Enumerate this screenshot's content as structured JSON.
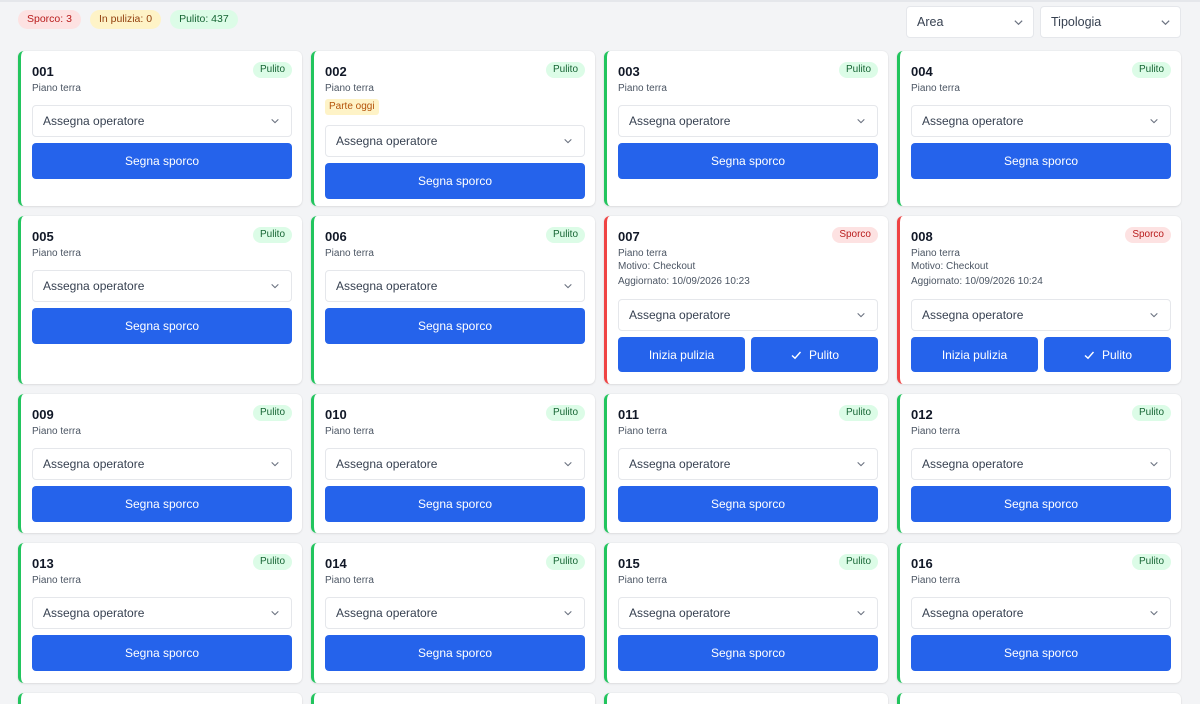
{
  "summary": {
    "dirty": "Sporco: 3",
    "cleaning": "In pulizia: 0",
    "clean": "Pulito: 437"
  },
  "filters": {
    "area": "Area",
    "type": "Tipologia"
  },
  "labels": {
    "assign": "Assegna operatore",
    "mark_dirty": "Segna sporco",
    "start_cleaning": "Inizia pulizia",
    "clean": "Pulito"
  },
  "colors": {
    "primary": "#2563eb",
    "clean": "#22c55e",
    "dirty": "#ef4444"
  },
  "rooms": [
    {
      "number": "001",
      "floor": "Piano terra",
      "status": "Pulito"
    },
    {
      "number": "002",
      "floor": "Piano terra",
      "status": "Pulito",
      "tag": "Parte oggi"
    },
    {
      "number": "003",
      "floor": "Piano terra",
      "status": "Pulito"
    },
    {
      "number": "004",
      "floor": "Piano terra",
      "status": "Pulito"
    },
    {
      "number": "005",
      "floor": "Piano terra",
      "status": "Pulito"
    },
    {
      "number": "006",
      "floor": "Piano terra",
      "status": "Pulito"
    },
    {
      "number": "007",
      "floor": "Piano terra",
      "status": "Sporco",
      "reason": "Motivo: Checkout",
      "updated": "Aggiornato: 10/09/2026 10:23"
    },
    {
      "number": "008",
      "floor": "Piano terra",
      "status": "Sporco",
      "reason": "Motivo: Checkout",
      "updated": "Aggiornato: 10/09/2026 10:24"
    },
    {
      "number": "009",
      "floor": "Piano terra",
      "status": "Pulito"
    },
    {
      "number": "010",
      "floor": "Piano terra",
      "status": "Pulito"
    },
    {
      "number": "011",
      "floor": "Piano terra",
      "status": "Pulito"
    },
    {
      "number": "012",
      "floor": "Piano terra",
      "status": "Pulito"
    },
    {
      "number": "013",
      "floor": "Piano terra",
      "status": "Pulito"
    },
    {
      "number": "014",
      "floor": "Piano terra",
      "status": "Pulito"
    },
    {
      "number": "015",
      "floor": "Piano terra",
      "status": "Pulito"
    },
    {
      "number": "016",
      "floor": "Piano terra",
      "status": "Pulito"
    }
  ]
}
